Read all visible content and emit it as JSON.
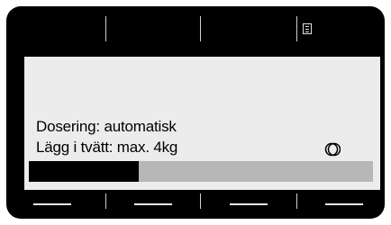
{
  "dosing_line": "Dosering: automatisk",
  "load_line": "Lägg i tvätt: max. 4kg",
  "progress": {
    "fraction": 0.32
  },
  "icons": {
    "menu": "list-icon",
    "status": "rinse-cycle-icon"
  },
  "colors": {
    "frame": "#000000",
    "screen": "#ececec",
    "track": "#b7b7b7",
    "fill": "#000000"
  }
}
